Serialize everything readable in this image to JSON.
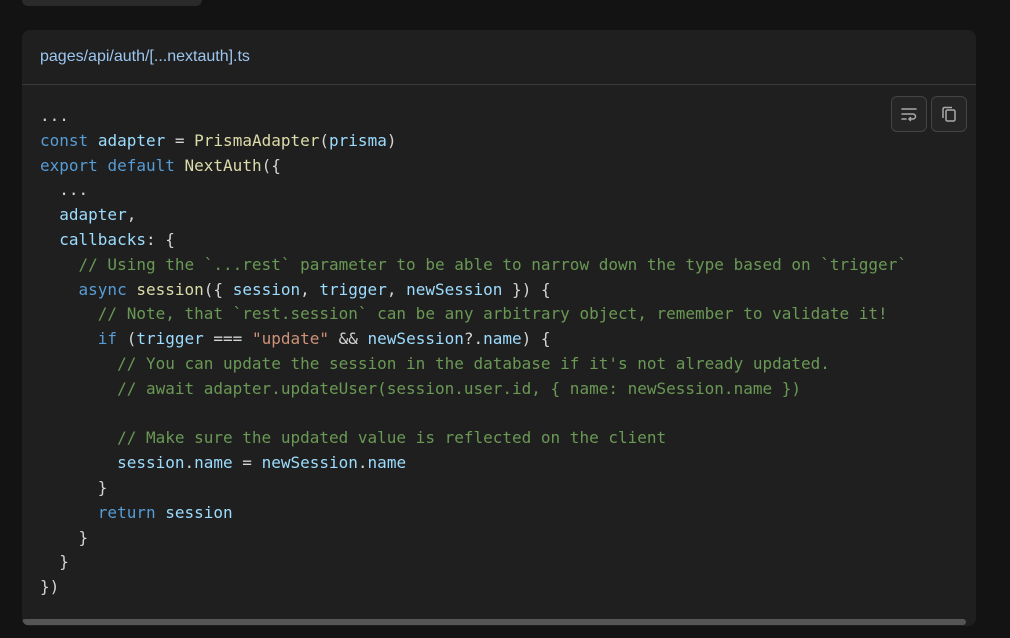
{
  "code_block": {
    "filename": "pages/api/auth/[...nextauth].ts",
    "wrap_button_icon": "wrap-lines-icon",
    "copy_button_icon": "copy-icon",
    "lines": [
      [
        {
          "t": "...",
          "c": "punc"
        }
      ],
      [
        {
          "t": "const",
          "c": "kw"
        },
        {
          "t": " ",
          "c": "punc"
        },
        {
          "t": "adapter",
          "c": "var"
        },
        {
          "t": " = ",
          "c": "punc"
        },
        {
          "t": "PrismaAdapter",
          "c": "fn"
        },
        {
          "t": "(",
          "c": "punc"
        },
        {
          "t": "prisma",
          "c": "var"
        },
        {
          "t": ")",
          "c": "punc"
        }
      ],
      [
        {
          "t": "export",
          "c": "kw"
        },
        {
          "t": " ",
          "c": "punc"
        },
        {
          "t": "default",
          "c": "kw"
        },
        {
          "t": " ",
          "c": "punc"
        },
        {
          "t": "NextAuth",
          "c": "fn"
        },
        {
          "t": "({",
          "c": "punc"
        }
      ],
      [
        {
          "t": "  ...",
          "c": "punc"
        }
      ],
      [
        {
          "t": "  ",
          "c": "punc"
        },
        {
          "t": "adapter",
          "c": "var"
        },
        {
          "t": ",",
          "c": "punc"
        }
      ],
      [
        {
          "t": "  ",
          "c": "punc"
        },
        {
          "t": "callbacks",
          "c": "var"
        },
        {
          "t": ": {",
          "c": "punc"
        }
      ],
      [
        {
          "t": "    // Using the `...rest` parameter to be able to narrow down the type based on `trigger`",
          "c": "cm"
        }
      ],
      [
        {
          "t": "    ",
          "c": "punc"
        },
        {
          "t": "async",
          "c": "kw"
        },
        {
          "t": " ",
          "c": "punc"
        },
        {
          "t": "session",
          "c": "fn"
        },
        {
          "t": "({ ",
          "c": "punc"
        },
        {
          "t": "session",
          "c": "var"
        },
        {
          "t": ", ",
          "c": "punc"
        },
        {
          "t": "trigger",
          "c": "var"
        },
        {
          "t": ", ",
          "c": "punc"
        },
        {
          "t": "newSession",
          "c": "var"
        },
        {
          "t": " }) {",
          "c": "punc"
        }
      ],
      [
        {
          "t": "      // Note, that `rest.session` can be any arbitrary object, remember to validate it!",
          "c": "cm"
        }
      ],
      [
        {
          "t": "      ",
          "c": "punc"
        },
        {
          "t": "if",
          "c": "kw"
        },
        {
          "t": " (",
          "c": "punc"
        },
        {
          "t": "trigger",
          "c": "var"
        },
        {
          "t": " === ",
          "c": "punc"
        },
        {
          "t": "\"update\"",
          "c": "str"
        },
        {
          "t": " && ",
          "c": "punc"
        },
        {
          "t": "newSession",
          "c": "var"
        },
        {
          "t": "?.",
          "c": "punc"
        },
        {
          "t": "name",
          "c": "var"
        },
        {
          "t": ") {",
          "c": "punc"
        }
      ],
      [
        {
          "t": "        // You can update the session in the database if it's not already updated.",
          "c": "cm"
        }
      ],
      [
        {
          "t": "        // await adapter.updateUser(session.user.id, { name: newSession.name })",
          "c": "cm"
        }
      ],
      [
        {
          "t": "",
          "c": "punc"
        }
      ],
      [
        {
          "t": "        // Make sure the updated value is reflected on the client",
          "c": "cm"
        }
      ],
      [
        {
          "t": "        ",
          "c": "punc"
        },
        {
          "t": "session",
          "c": "var"
        },
        {
          "t": ".",
          "c": "punc"
        },
        {
          "t": "name",
          "c": "var"
        },
        {
          "t": " = ",
          "c": "punc"
        },
        {
          "t": "newSession",
          "c": "var"
        },
        {
          "t": ".",
          "c": "punc"
        },
        {
          "t": "name",
          "c": "var"
        }
      ],
      [
        {
          "t": "      }",
          "c": "punc"
        }
      ],
      [
        {
          "t": "      ",
          "c": "punc"
        },
        {
          "t": "return",
          "c": "kw"
        },
        {
          "t": " ",
          "c": "punc"
        },
        {
          "t": "session",
          "c": "var"
        }
      ],
      [
        {
          "t": "    }",
          "c": "punc"
        }
      ],
      [
        {
          "t": "  }",
          "c": "punc"
        }
      ],
      [
        {
          "t": "})",
          "c": "punc"
        }
      ]
    ]
  },
  "colors": {
    "background": "#131313",
    "panel": "#1f1f1f",
    "keyword": "#569cd6",
    "function": "#dcdcaa",
    "variable": "#9cdcfe",
    "string": "#ce9178",
    "comment": "#6a9955",
    "filename": "#9cc6f0"
  }
}
